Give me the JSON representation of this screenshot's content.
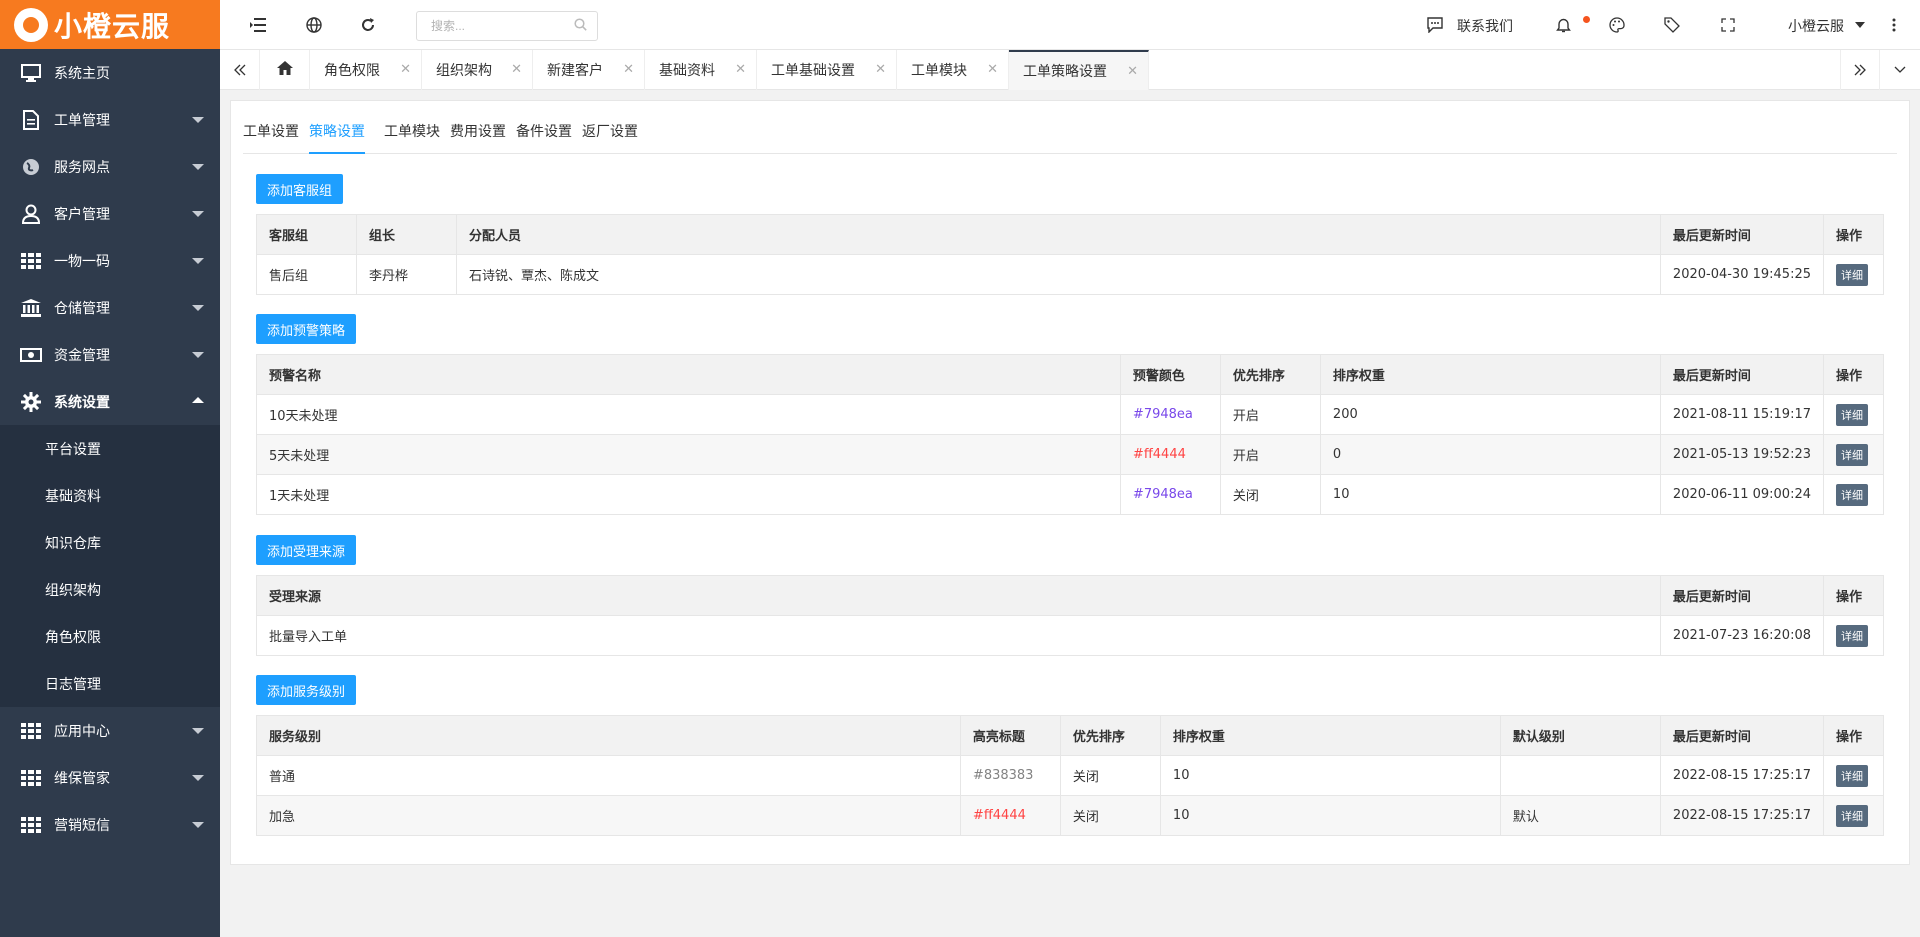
{
  "app": {
    "logo_text": "小橙云服"
  },
  "sidebar": {
    "items": [
      {
        "label": "系统主页",
        "icon": "monitor-icon"
      },
      {
        "label": "工单管理",
        "icon": "document-icon"
      },
      {
        "label": "服务网点",
        "icon": "globe-icon"
      },
      {
        "label": "客户管理",
        "icon": "user-icon"
      },
      {
        "label": "一物一码",
        "icon": "grid-icon"
      },
      {
        "label": "仓储管理",
        "icon": "bank-icon"
      },
      {
        "label": "资金管理",
        "icon": "money-icon"
      },
      {
        "label": "系统设置",
        "icon": "gear-icon"
      }
    ],
    "submenu": [
      "平台设置",
      "基础资料",
      "知识仓库",
      "组织架构",
      "角色权限",
      "日志管理"
    ],
    "bottom_items": [
      {
        "label": "应用中心",
        "icon": "grid-icon"
      },
      {
        "label": "维保管家",
        "icon": "grid-icon"
      },
      {
        "label": "营销短信",
        "icon": "grid-icon"
      }
    ]
  },
  "topbar": {
    "search_placeholder": "搜索...",
    "contact_label": "联系我们",
    "user_label": "小橙云服"
  },
  "tabs": [
    "角色权限",
    "组织架构",
    "新建客户",
    "基础资料",
    "工单基础设置",
    "工单模块",
    "工单策略设置"
  ],
  "subtabs": [
    "工单设置",
    "策略设置",
    "工单模块",
    "费用设置",
    "备件设置",
    "返厂设置"
  ],
  "groups": {
    "add_label": "添加客服组",
    "headers": [
      "客服组",
      "组长",
      "分配人员",
      "最后更新时间",
      "操作"
    ],
    "rows": [
      {
        "name": "售后组",
        "leader": "李丹桦",
        "members": "石诗锐、覃杰、陈成文",
        "updated": "2020-04-30 19:45:25",
        "action": "详细"
      }
    ]
  },
  "alerts": {
    "add_label": "添加预警策略",
    "headers": [
      "预警名称",
      "预警颜色",
      "优先排序",
      "排序权重",
      "最后更新时间",
      "操作"
    ],
    "rows": [
      {
        "name": "10天未处理",
        "color": "#7948ea",
        "priority": "开启",
        "weight": "200",
        "updated": "2021-08-11 15:19:17",
        "action": "详细"
      },
      {
        "name": "5天未处理",
        "color": "#ff4444",
        "priority": "开启",
        "weight": "0",
        "updated": "2021-05-13 19:52:23",
        "action": "详细"
      },
      {
        "name": "1天未处理",
        "color": "#7948ea",
        "priority": "关闭",
        "weight": "10",
        "updated": "2020-06-11 09:00:24",
        "action": "详细"
      }
    ]
  },
  "sources": {
    "add_label": "添加受理来源",
    "headers": [
      "受理来源",
      "最后更新时间",
      "操作"
    ],
    "rows": [
      {
        "name": "批量导入工单",
        "updated": "2021-07-23 16:20:08",
        "action": "详细"
      }
    ]
  },
  "levels": {
    "add_label": "添加服务级别",
    "headers": [
      "服务级别",
      "高亮标题",
      "优先排序",
      "排序权重",
      "默认级别",
      "最后更新时间",
      "操作"
    ],
    "rows": [
      {
        "name": "普通",
        "highlight": "#838383",
        "priority": "关闭",
        "weight": "10",
        "default": "",
        "updated": "2022-08-15 17:25:17",
        "action": "详细"
      },
      {
        "name": "加急",
        "highlight": "#ff4444",
        "priority": "关闭",
        "weight": "10",
        "default": "默认",
        "updated": "2022-08-15 17:25:17",
        "action": "详细"
      }
    ]
  },
  "colors": {
    "brand": "#f77a1f",
    "sidebar": "#2f3b4c",
    "accent": "#1e9fff"
  }
}
